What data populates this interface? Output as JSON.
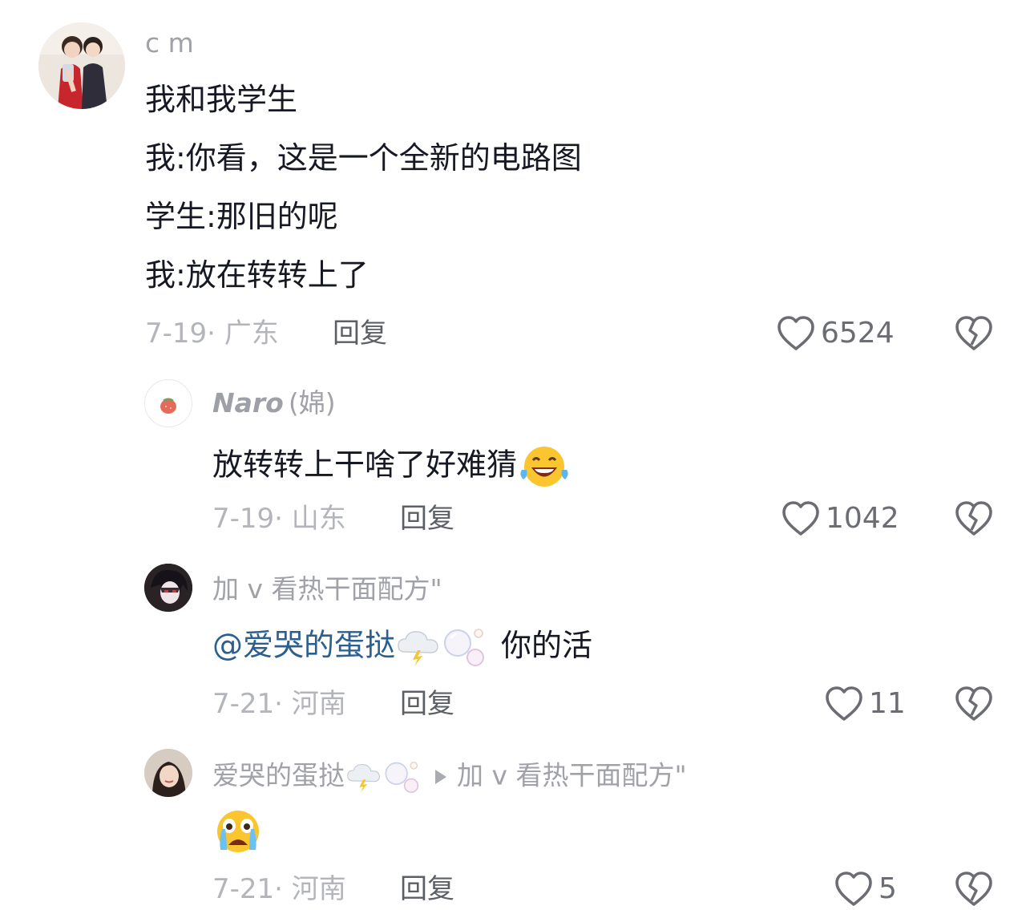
{
  "comments": [
    {
      "username": "c m",
      "lines": [
        "我和我学生",
        "我:你看，这是一个全新的电路图",
        "学生:那旧的呢",
        "我:放在转转上了"
      ],
      "meta": "7-19· 广东",
      "reply_label": "回复",
      "likes": "6524",
      "avatar_icon": "photo-avatar"
    },
    {
      "username": "Naro",
      "tag": "(婂)",
      "text": "放转转上干啥了好难猜",
      "emoji": "laughing-tears-emoji",
      "meta": "7-19· 山东",
      "reply_label": "回复",
      "likes": "1042",
      "avatar_icon": "strawberry-avatar"
    },
    {
      "username": "加 v 看热干面配方\"",
      "mention": "@爱哭的蛋挞",
      "text": "你的活",
      "emoji": [
        "storm-cloud-emoji",
        "bubbles-emoji"
      ],
      "meta": "7-21· 河南",
      "reply_label": "回复",
      "likes": "11",
      "avatar_icon": "anime-avatar"
    },
    {
      "username": "爱哭的蛋挞",
      "reply_to": "加 v 看热干面配方\"",
      "emoji": [
        "storm-cloud-emoji",
        "bubbles-emoji",
        "crying-face-emoji"
      ],
      "meta": "7-21· 河南",
      "reply_label": "回复",
      "likes": "5",
      "avatar_icon": "girl-avatar"
    }
  ],
  "icons": {
    "like": "heart-outline-icon",
    "dislike": "broken-heart-icon",
    "reply_arrow": "triangle-right-icon"
  },
  "colors": {
    "text": "#161823",
    "secondary": "#a0a2a8",
    "mention": "#2b5f8f"
  }
}
